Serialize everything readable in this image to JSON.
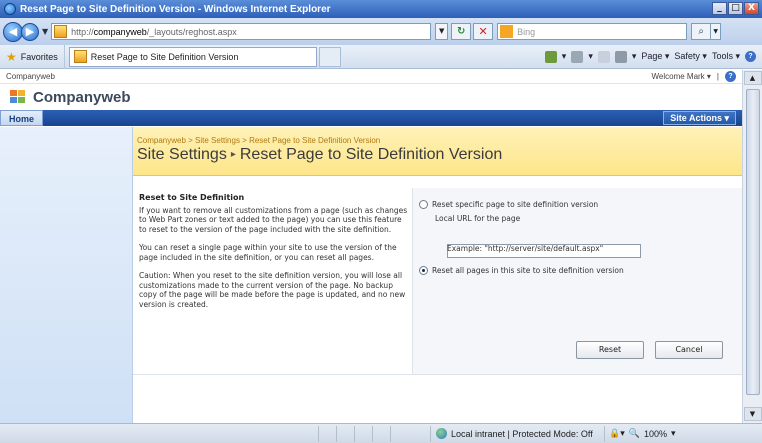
{
  "window": {
    "title": "Reset Page to Site Definition Version - Windows Internet Explorer",
    "min": "_",
    "max": "□",
    "close": "X"
  },
  "address_bar": {
    "url_prefix": "http://",
    "url_host": "companyweb",
    "url_path": "/_layouts/reghost.aspx",
    "search_placeholder": "Bing"
  },
  "favorites_bar": {
    "favorites_label": "Favorites",
    "tab_title": "Reset Page to Site Definition Version",
    "commands": [
      "Page ▾",
      "Safety ▾",
      "Tools ▾"
    ]
  },
  "sharepoint": {
    "site_link": "Companyweb",
    "welcome": "Welcome Mark ▾",
    "site_title": "Companyweb",
    "home_tab": "Home",
    "site_actions": "Site Actions ▾",
    "breadcrumb": "Companyweb > Site Settings > Reset Page to Site Definition Version",
    "page_title_part1": "Site Settings",
    "page_title_sep": "▸",
    "page_title_part2": "Reset Page to Site Definition Version"
  },
  "section": {
    "heading": "Reset to Site Definition",
    "para1": "If you want to remove all customizations from a page (such as changes to Web Part zones or text added to the page) you can use this feature to reset to the version of the page included with the site definition.",
    "para2": "You can reset a single page within your site to use the version of the page included in the site definition, or you can reset all pages.",
    "para3": "Caution: When you reset to the site definition version, you will lose all customizations made to the current version of the page. No backup copy of the page will be made before the page is updated, and no new version is created."
  },
  "form": {
    "option_specific": "Reset specific page to site definition version",
    "local_url_label": "Local URL for the page",
    "local_url_value": "",
    "example": "Example: \"http://server/site/default.aspx\"",
    "option_all": "Reset all pages in this site to site definition version",
    "selected_option": "all",
    "reset_button": "Reset",
    "cancel_button": "Cancel"
  },
  "status_bar": {
    "zone": "Local intranet | Protected Mode: Off",
    "zoom": "100%"
  }
}
